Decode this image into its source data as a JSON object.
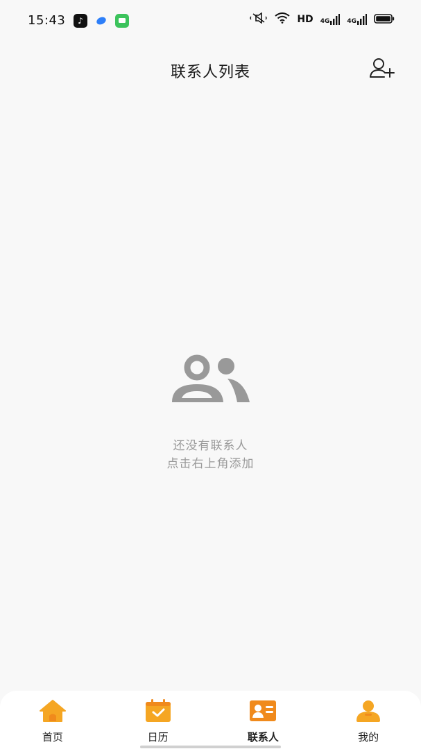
{
  "status_bar": {
    "time": "15:43",
    "network_label": "HD",
    "signal_1_label": "4G",
    "signal_2_label": "4G"
  },
  "header": {
    "title": "联系人列表"
  },
  "empty_state": {
    "line1": "还没有联系人",
    "line2": "点击右上角添加"
  },
  "tabs": [
    {
      "label": "首页",
      "icon": "home-icon",
      "active": false
    },
    {
      "label": "日历",
      "icon": "calendar-icon",
      "active": false
    },
    {
      "label": "联系人",
      "icon": "contact-card-icon",
      "active": true
    },
    {
      "label": "我的",
      "icon": "profile-icon",
      "active": false
    }
  ],
  "colors": {
    "accent": "#f5a623",
    "accent_dark": "#f08a1c",
    "background": "#f8f8f8",
    "empty_icon": "#999999",
    "empty_text": "#9a9a9a"
  }
}
